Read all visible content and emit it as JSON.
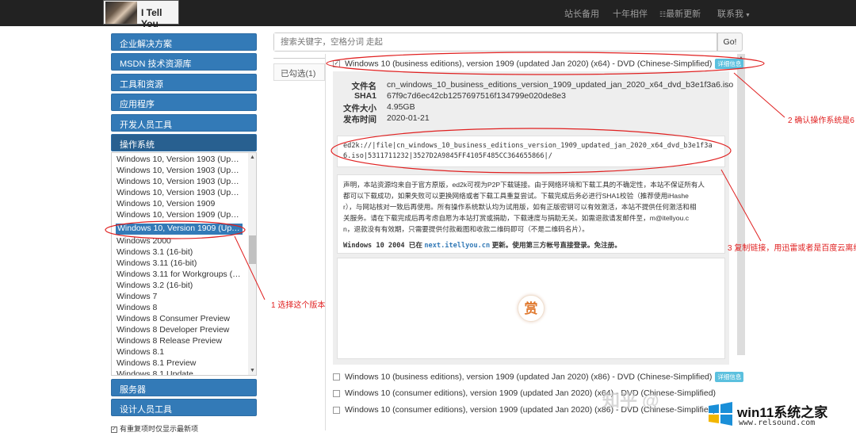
{
  "header": {
    "logo_text": "I Tell You",
    "nav": [
      "站长备用",
      "十年相伴",
      "最新更新",
      "联系我"
    ],
    "rss_icon": "rss-icon"
  },
  "sidebar": {
    "categories_top": [
      "企业解决方案",
      "MSDN 技术资源库",
      "工具和资源",
      "应用程序",
      "开发人员工具",
      "操作系统"
    ],
    "categories_bottom": [
      "服务器",
      "设计人员工具"
    ],
    "os_list": [
      "Windows 10, Version 1903 (Upda...",
      "Windows 10, Version 1903 (Upda...",
      "Windows 10, Version 1903 (Upda...",
      "Windows 10, Version 1903 (Upda...",
      "Windows 10, Version 1909",
      "Windows 10, Version 1909 (Upda...",
      "Windows 10, Version 1909 (Upd...",
      "Windows 2000",
      "Windows 3.1 (16-bit)",
      "Windows 3.11 (16-bit)",
      "Windows 3.11 for Workgroups (1...",
      "Windows 3.2 (16-bit)",
      "Windows 7",
      "Windows 8",
      "Windows 8 Consumer Preview",
      "Windows 8 Developer Preview",
      "Windows 8 Release Preview",
      "Windows 8.1",
      "Windows 8.1 Preview",
      "Windows 8.1 Update"
    ],
    "selected_index": 6,
    "option_label": "有重复项时仅显示最新项"
  },
  "search": {
    "placeholder": "搜索关键字，空格分词 走起",
    "go_label": "Go!",
    "selected_tab": "已勾选(1)"
  },
  "main": {
    "selected_item": {
      "title": "Windows 10 (business editions), version 1909 (updated Jan 2020) (x64) - DVD (Chinese-Simplified)",
      "badge": "详细信息",
      "details": [
        {
          "key": "文件名",
          "value": "cn_windows_10_business_editions_version_1909_updated_jan_2020_x64_dvd_b3e1f3a6.iso"
        },
        {
          "key": "SHA1",
          "value": "67f9c7d6ec42cb1257697516f134799e020de8e3"
        },
        {
          "key": "文件大小",
          "value": "4.95GB"
        },
        {
          "key": "发布时间",
          "value": "2020-01-21"
        }
      ],
      "ed2k": "ed2k://|file|cn_windows_10_business_editions_version_1909_updated_jan_2020_x64_dvd_b3e1f3a6.iso|5311711232|3527D2A9845FF4105F485CC364655866|/",
      "notice_lines": [
        "声明，本站资源均来自于官方原版，ed2k可视为P2P下载链接。由于网络环境和下载工具的不确定性，本站不保证所有人",
        "都可以下载成功，如果失败可以更换网络或者下载工具重复尝试。下载完成后务必进行SHA1校验（推荐使用iHashe",
        "r），与网站核对一致后再使用。所有操作系统默认均为试用版，如有正版密钥可以有效激活，本站不提供任何激活和相",
        "关服务。请在下载完成后再考虑自愿为本站打赏或捐助，下载速度与捐助无关。如需退款请发邮件至，m@itellyou.c",
        "n，退款没有有效期，只需要提供付款截图和收款二维码即可（不是二维码名片）。"
      ],
      "notice_footer_pre": "Windows 10 2004 已在",
      "notice_footer_link": "next.itellyou.cn",
      "notice_footer_post": "更新。使用第三方帐号直接登录。免注册。",
      "reward_label": "赏"
    },
    "other_items": [
      {
        "title": "Windows 10 (business editions), version 1909 (updated Jan 2020) (x86) - DVD (Chinese-Simplified)",
        "badge": "详细信息"
      },
      {
        "title": "Windows 10 (consumer editions), version 1909 (updated Jan 2020) (x64) - DVD (Chinese-Simplified)",
        "badge": ""
      },
      {
        "title": "Windows 10 (consumer editions), version 1909 (updated Jan 2020) (x86) - DVD (Chinese-Simplified)",
        "badge": ""
      }
    ]
  },
  "annotations": {
    "a1": "1  选择这个版本",
    "a2": "2  确认操作系统是6",
    "a3": "3  复制链接，用迅雷或者是百度云离线"
  },
  "watermark": {
    "zhihu": "知乎 @",
    "site_title": "win11系统之家",
    "site_url": "www.relsound.com"
  }
}
